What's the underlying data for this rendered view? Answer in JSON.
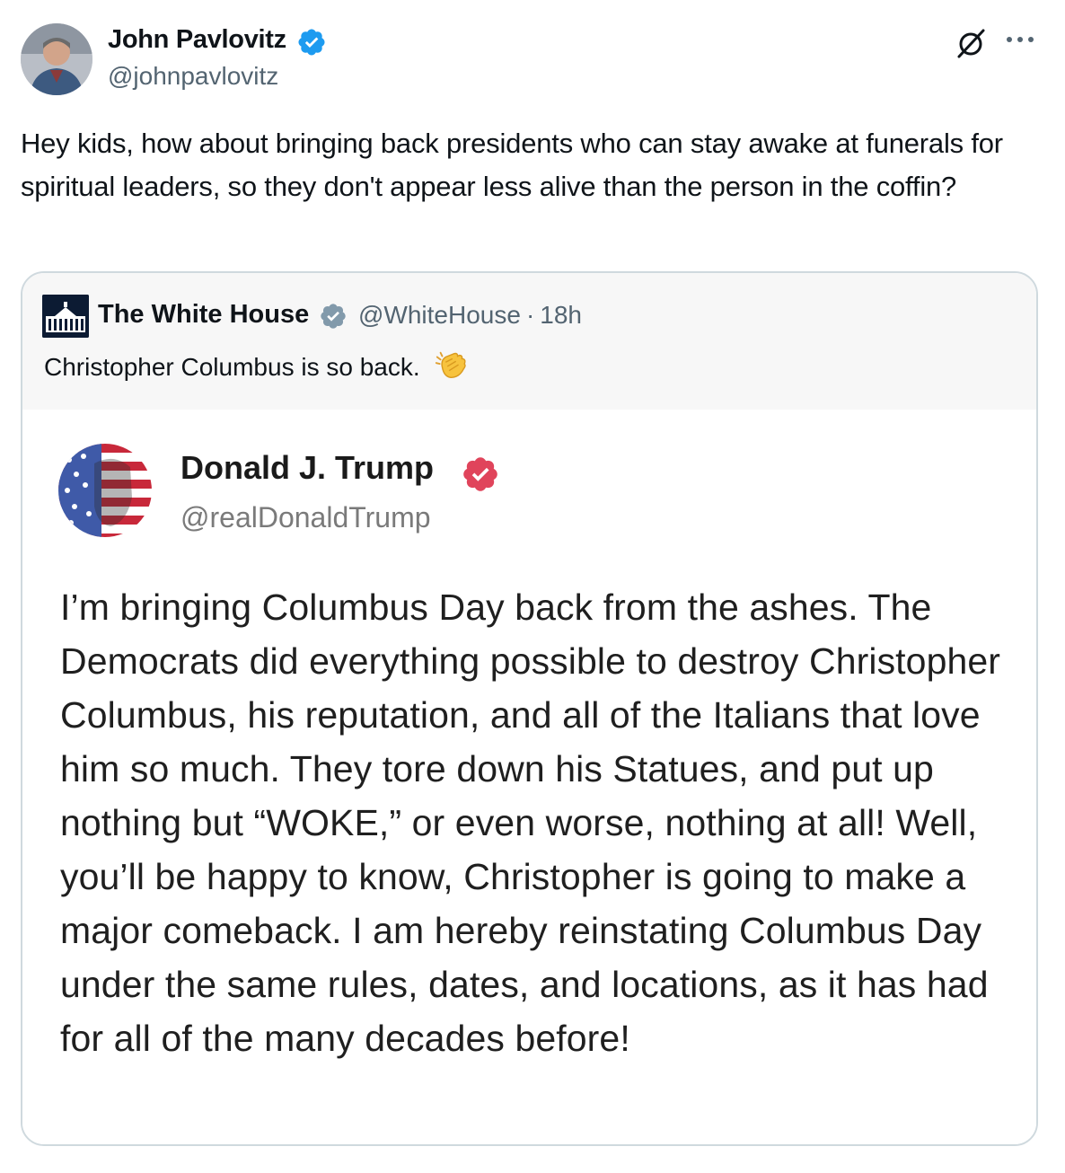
{
  "author": {
    "name": "John Pavlovitz",
    "handle": "@johnpavlovitz"
  },
  "icons": {
    "verified": "verified-badge-icon",
    "grok": "grok-icon",
    "more": "more-options-icon",
    "clap": "clapping-hands-emoji",
    "affiliate": "government-affiliate-badge-icon"
  },
  "colors": {
    "verified_blue": "#1d9bf0",
    "handle_gray": "#536471",
    "truth_badge_pink": "#e0445b",
    "white_house_navy": "#0c1b33"
  },
  "tweet": {
    "text": "Hey kids, how about bringing back presidents who can stay awake at funerals for spiritual leaders, so they don't appear less alive than the person in the coffin?"
  },
  "quote": {
    "name": "The White House",
    "handle": "@WhiteHouse",
    "separator": "·",
    "time": "18h",
    "text": "Christopher Columbus is so back.",
    "image": {
      "name": "Donald J. Trump",
      "handle": "@realDonaldTrump",
      "text": "I’m bringing Columbus Day back from the ashes. The Democrats did everything possible to destroy Christopher Columbus, his reputation, and all of the Italians that love him so much. They tore down his Statues, and put up nothing but “WOKE,” or even worse, nothing at all! Well, you’ll be happy to know, Christopher is going to make a major comeback. I am hereby reinstating Columbus Day under the same rules, dates, and locations, as it has had for all of the many decades before!"
    }
  }
}
